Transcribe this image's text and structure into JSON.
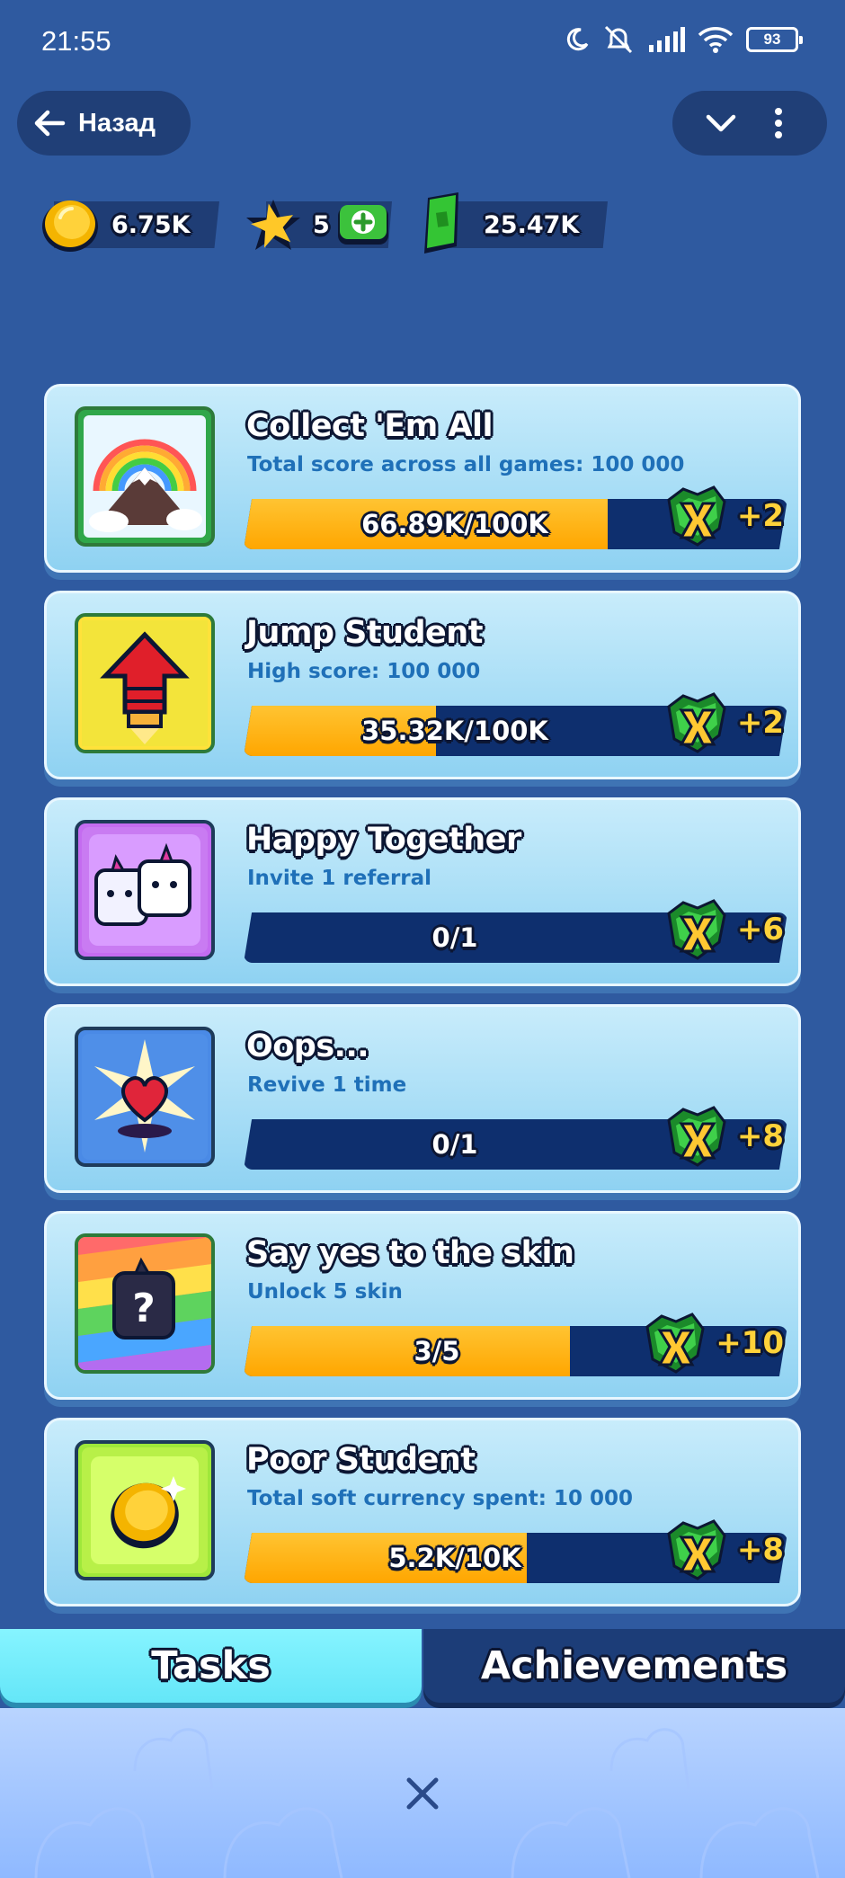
{
  "status_bar": {
    "time": "21:55",
    "battery": "93"
  },
  "nav": {
    "back_label": "Назад"
  },
  "currencies": {
    "coins": "6.75K",
    "stars": "5",
    "tickets": "25.47K"
  },
  "tasks": [
    {
      "title": "Collect 'Em All",
      "subtitle": "Total score across all games: 100 000",
      "progress": "66.89K/100K",
      "progress_fraction": 0.6689,
      "reward": "+2"
    },
    {
      "title": "Jump Student",
      "subtitle": "High score: 100 000",
      "progress": "35.32K/100K",
      "progress_fraction": 0.3532,
      "reward": "+2"
    },
    {
      "title": "Happy Together",
      "subtitle": "Invite 1 referral",
      "progress": "0/1",
      "progress_fraction": 0,
      "reward": "+6"
    },
    {
      "title": "Oops...",
      "subtitle": "Revive 1 time",
      "progress": "0/1",
      "progress_fraction": 0,
      "reward": "+8"
    },
    {
      "title": "Say yes to the skin",
      "subtitle": "Unlock 5 skin",
      "progress": "3/5",
      "progress_fraction": 0.6,
      "reward": "+10"
    },
    {
      "title": "Poor Student",
      "subtitle": "Total soft currency spent: 10 000",
      "progress": "5.2K/10K",
      "progress_fraction": 0.52,
      "reward": "+8"
    }
  ],
  "tabs": {
    "tasks": "Tasks",
    "achievements": "Achievements",
    "active": "tasks"
  },
  "colors": {
    "background": "#2f5aa0",
    "accent_yellow": "#ffc432",
    "tab_active": "#86f4ff"
  }
}
